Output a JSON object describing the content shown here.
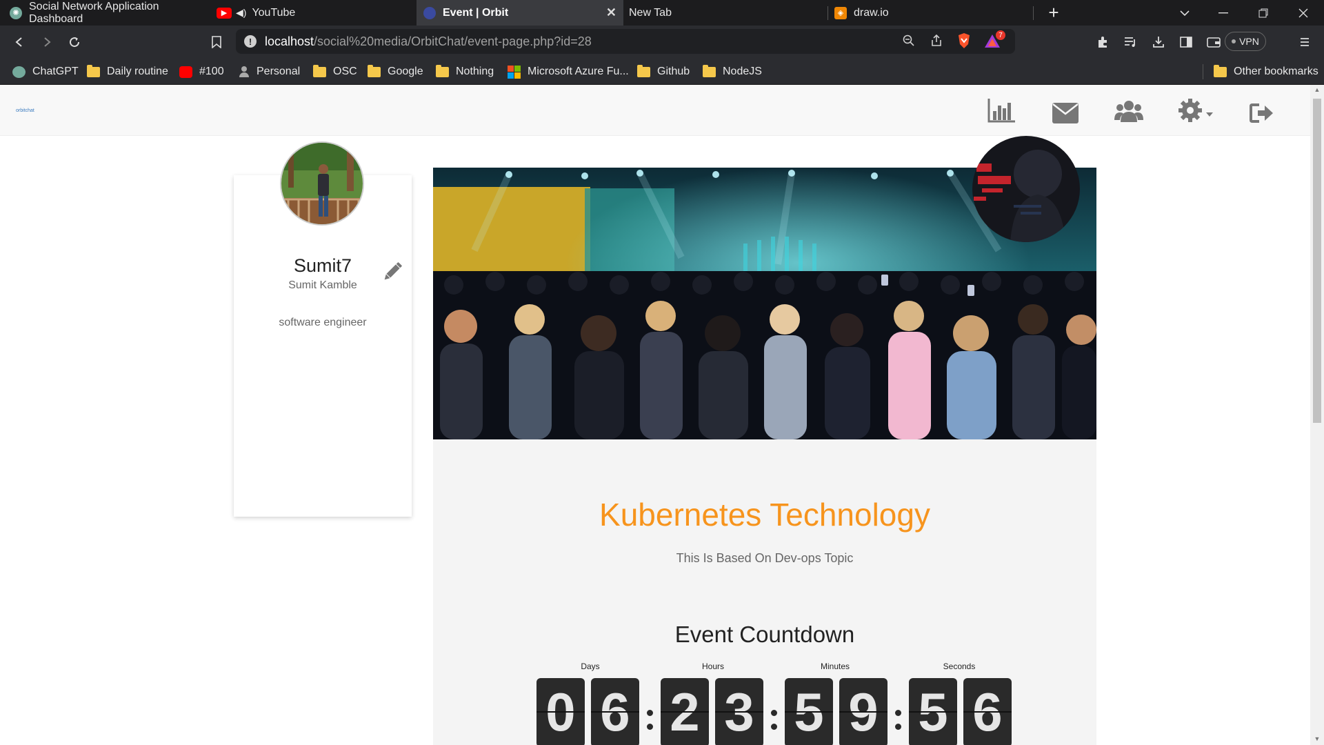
{
  "browser": {
    "tabs": [
      {
        "label": "Social Network Application Dashboard",
        "icon": "chatgpt-icon",
        "active": false
      },
      {
        "label": "YouTube",
        "icon": "youtube-icon",
        "audio": true,
        "active": false
      },
      {
        "label": "Event | Orbit",
        "icon": "orbit-icon",
        "active": true
      },
      {
        "label": "New Tab",
        "active": false
      },
      {
        "label": "draw.io",
        "icon": "drawio-icon",
        "active": false
      }
    ],
    "new_tab_glyph": "+",
    "url_host": "localhost",
    "url_path": "/social%20media/OrbitChat/event-page.php?id=28",
    "vpn_label": "VPN",
    "brave_rewards_count": "7",
    "bookmarks": [
      {
        "label": "ChatGPT",
        "icon": "chatgpt-icon"
      },
      {
        "label": "Daily routine",
        "icon": "folder-icon"
      },
      {
        "label": "#100",
        "icon": "youtube-icon"
      },
      {
        "label": "Personal",
        "icon": "person-icon"
      },
      {
        "label": "OSC",
        "icon": "folder-icon"
      },
      {
        "label": "Google",
        "icon": "folder-icon"
      },
      {
        "label": "Nothing",
        "icon": "folder-icon"
      },
      {
        "label": "Microsoft Azure Fu...",
        "icon": "microsoft-icon"
      },
      {
        "label": "Github",
        "icon": "folder-icon"
      },
      {
        "label": "NodeJS",
        "icon": "folder-icon"
      }
    ],
    "other_bookmarks": "Other bookmarks"
  },
  "site": {
    "brand": "orbitchat",
    "nav_icons": [
      "bar-chart-icon",
      "envelope-icon",
      "users-icon",
      "gear-icon",
      "sign-out-icon"
    ]
  },
  "profile": {
    "username": "Sumit7",
    "full_name": "Sumit Kamble",
    "bio": "software engineer"
  },
  "event": {
    "title": "Kubernetes Technology",
    "description": "This Is Based On Dev-ops Topic",
    "countdown_title": "Event Countdown",
    "labels": {
      "days": "Days",
      "hours": "Hours",
      "minutes": "Minutes",
      "seconds": "Seconds"
    },
    "digits": {
      "days": [
        "0",
        "6"
      ],
      "hours": [
        "2",
        "3"
      ],
      "minutes": [
        "5",
        "9"
      ],
      "seconds": [
        "5",
        "6"
      ]
    }
  },
  "colors": {
    "accent_orange": "#f7941d",
    "tab_active": "#3a3b3f",
    "chrome_dark": "#1c1c1e"
  }
}
